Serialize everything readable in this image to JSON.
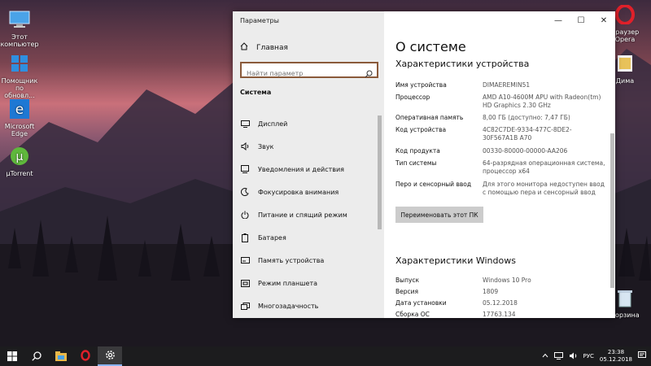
{
  "desktop": {
    "icons": [
      {
        "label": "Этот компьютер"
      },
      {
        "label": "Помощник по обновл..."
      },
      {
        "label": "Microsoft Edge"
      },
      {
        "label": "µTorrent"
      },
      {
        "label": "Браузер Opera"
      },
      {
        "label": "Дима"
      },
      {
        "label": "Корзина"
      }
    ]
  },
  "window": {
    "title": "Параметры",
    "controls": {
      "minimize": "—",
      "maximize": "☐",
      "close": "✕"
    }
  },
  "nav": {
    "home_label": "Главная",
    "search_placeholder": "Найти параметр",
    "section_label": "Система",
    "items": [
      {
        "label": "Дисплей",
        "icon": "display-icon"
      },
      {
        "label": "Звук",
        "icon": "sound-icon"
      },
      {
        "label": "Уведомления и действия",
        "icon": "notifications-icon"
      },
      {
        "label": "Фокусировка внимания",
        "icon": "focus-icon"
      },
      {
        "label": "Питание и спящий режим",
        "icon": "power-icon"
      },
      {
        "label": "Батарея",
        "icon": "battery-icon"
      },
      {
        "label": "Память устройства",
        "icon": "storage-icon"
      },
      {
        "label": "Режим планшета",
        "icon": "tablet-icon"
      },
      {
        "label": "Многозадачность",
        "icon": "multitasking-icon"
      }
    ]
  },
  "content": {
    "page_title": "О системе",
    "device_heading": "Характеристики устройства",
    "device_specs": [
      {
        "key": "Имя устройства",
        "value": "DIMAEREMIN51"
      },
      {
        "key": "Процессор",
        "value": "AMD A10-4600M APU with Radeon(tm) HD Graphics    2.30 GHz"
      },
      {
        "key": "Оперативная память",
        "value": "8,00 ГБ (доступно: 7,47 ГБ)"
      },
      {
        "key": "Код устройства",
        "value": "4C82C7DE-9334-477C-8DE2-30F567A1B A70"
      },
      {
        "key": "Код продукта",
        "value": "00330-80000-00000-AA206"
      },
      {
        "key": "Тип системы",
        "value": "64-разрядная операционная система, процессор x64"
      },
      {
        "key": "Перо и сенсорный ввод",
        "value": "Для этого монитора недоступен ввод с помощью пера и сенсорный ввод"
      }
    ],
    "rename_button": "Переименовать этот ПК",
    "windows_heading": "Характеристики Windows",
    "windows_specs": [
      {
        "key": "Выпуск",
        "value": "Windows 10 Pro"
      },
      {
        "key": "Версия",
        "value": "1809"
      },
      {
        "key": "Дата установки",
        "value": "05.12.2018"
      },
      {
        "key": "Сборка ОС",
        "value": "17763.134"
      }
    ]
  },
  "taskbar": {
    "language": "РУС",
    "time": "23:38",
    "date": "05.12.2018"
  },
  "colors": {
    "accent": "#8a5a3a",
    "taskbar": "#1c1c1e",
    "nav_bg": "#ececec"
  }
}
